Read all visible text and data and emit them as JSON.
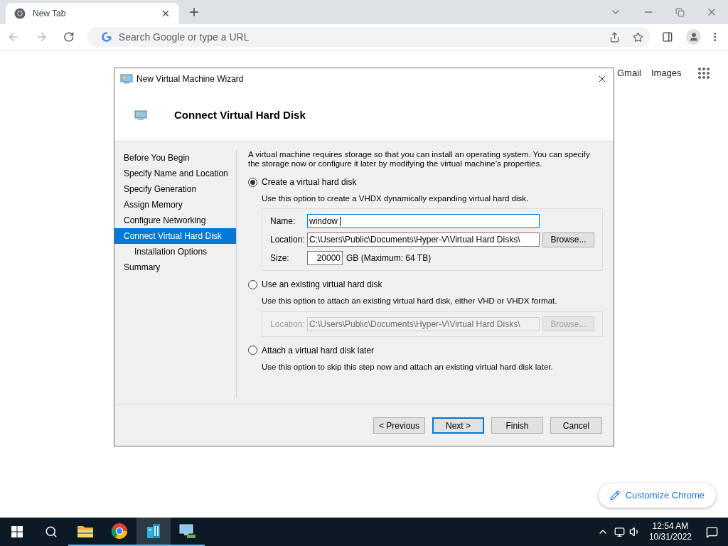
{
  "browser": {
    "tab": {
      "title": "New Tab",
      "selected": true
    },
    "omnibox": {
      "placeholder": "Search Google or type a URL"
    },
    "top_links": [
      "Gmail",
      "Images"
    ],
    "customize_button": "Customize Chrome"
  },
  "dialog": {
    "title": "New Virtual Machine Wizard",
    "heading": "Connect Virtual Hard Disk",
    "steps": [
      {
        "label": "Before You Begin",
        "selected": false
      },
      {
        "label": "Specify Name and Location",
        "selected": false
      },
      {
        "label": "Specify Generation",
        "selected": false
      },
      {
        "label": "Assign Memory",
        "selected": false
      },
      {
        "label": "Configure Networking",
        "selected": false
      },
      {
        "label": "Connect Virtual Hard Disk",
        "selected": true,
        "children": [
          {
            "label": "Installation Options",
            "selected": false
          }
        ]
      },
      {
        "label": "Summary",
        "selected": false
      }
    ],
    "intro": "A virtual machine requires storage so that you can install an operating system. You can specify the storage now or configure it later by modifying the virtual machine’s properties.",
    "options": [
      {
        "label": "Create a virtual hard disk",
        "selected": true,
        "description": "Use this option to create a VHDX dynamically expanding virtual hard disk.",
        "fields": [
          {
            "kind": "text",
            "label": "Name:",
            "value": "window ",
            "focused": true,
            "disabled": false
          },
          {
            "kind": "path",
            "label": "Location:",
            "value": "C:\\Users\\Public\\Documents\\Hyper-V\\Virtual Hard Disks\\",
            "button": "Browse...",
            "focused": false,
            "disabled": false
          },
          {
            "kind": "size",
            "label": "Size:",
            "value": "20000",
            "suffix": "GB (Maximum: 64 TB)",
            "focused": false,
            "disabled": false
          }
        ]
      },
      {
        "label": "Use an existing virtual hard disk",
        "selected": false,
        "description": "Use this option to attach an existing virtual hard disk, either VHD or VHDX format.",
        "fields": [
          {
            "kind": "path",
            "label": "Location:",
            "value": "C:\\Users\\Public\\Documents\\Hyper-V\\Virtual Hard Disks\\",
            "button": "Browse...",
            "focused": false,
            "disabled": true
          }
        ]
      },
      {
        "label": "Attach a virtual hard disk later",
        "selected": false,
        "description": "Use this option to skip this step now and attach an existing virtual hard disk later."
      }
    ],
    "buttons": [
      {
        "label": "< Previous",
        "focused": false
      },
      {
        "label": "Next >",
        "focused": true
      },
      {
        "label": "Finish",
        "focused": false
      },
      {
        "label": "Cancel",
        "focused": false
      }
    ]
  },
  "taskbar": {
    "apps": [
      {
        "kind": "folder",
        "selected": false
      },
      {
        "kind": "chrome",
        "selected": false
      },
      {
        "kind": "server",
        "selected": true
      },
      {
        "kind": "hyperv",
        "selected": false
      }
    ],
    "time": "12:54 AM",
    "date": "10/31/2022"
  }
}
